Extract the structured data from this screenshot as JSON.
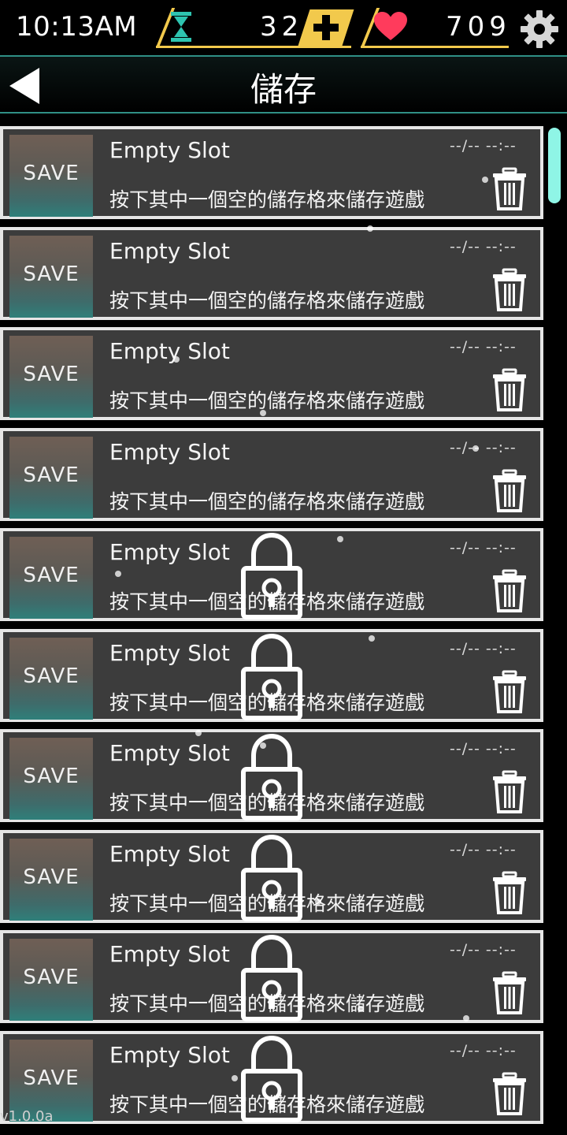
{
  "status_bar": {
    "time": "10:13AM",
    "time_value": "32",
    "life_value": "709",
    "icons": [
      "hourglass-icon",
      "plus-icon",
      "heart-icon",
      "gear-icon"
    ]
  },
  "header": {
    "title": "儲存",
    "back_icon": "back-arrow-icon"
  },
  "slots": [
    {
      "thumb_label": "SAVE",
      "title": "Empty Slot",
      "description": "按下其中一個空的儲存格來儲存遊戲",
      "date": "--/-- --:--",
      "locked": false
    },
    {
      "thumb_label": "SAVE",
      "title": "Empty Slot",
      "description": "按下其中一個空的儲存格來儲存遊戲",
      "date": "--/-- --:--",
      "locked": false
    },
    {
      "thumb_label": "SAVE",
      "title": "Empty Slot",
      "description": "按下其中一個空的儲存格來儲存遊戲",
      "date": "--/-- --:--",
      "locked": false
    },
    {
      "thumb_label": "SAVE",
      "title": "Empty Slot",
      "description": "按下其中一個空的儲存格來儲存遊戲",
      "date": "--/-- --:--",
      "locked": false
    },
    {
      "thumb_label": "SAVE",
      "title": "Empty Slot",
      "description": "按下其中一個空的儲存格來儲存遊戲",
      "date": "--/-- --:--",
      "locked": true
    },
    {
      "thumb_label": "SAVE",
      "title": "Empty Slot",
      "description": "按下其中一個空的儲存格來儲存遊戲",
      "date": "--/-- --:--",
      "locked": true
    },
    {
      "thumb_label": "SAVE",
      "title": "Empty Slot",
      "description": "按下其中一個空的儲存格來儲存遊戲",
      "date": "--/-- --:--",
      "locked": true
    },
    {
      "thumb_label": "SAVE",
      "title": "Empty Slot",
      "description": "按下其中一個空的儲存格來儲存遊戲",
      "date": "--/-- --:--",
      "locked": true
    },
    {
      "thumb_label": "SAVE",
      "title": "Empty Slot",
      "description": "按下其中一個空的儲存格來儲存遊戲",
      "date": "--/-- --:--",
      "locked": true
    },
    {
      "thumb_label": "SAVE",
      "title": "Empty Slot",
      "description": "按下其中一個空的儲存格來儲存遊戲",
      "date": "--/-- --:--",
      "locked": true
    }
  ],
  "version": "v1.0.0a",
  "colors": {
    "accent_gold": "#f2c94c",
    "accent_teal": "#2f8f85",
    "heart": "#ff3b5c",
    "slot_bg": "#3c3c3c",
    "slot_border": "#e6e6e6"
  }
}
